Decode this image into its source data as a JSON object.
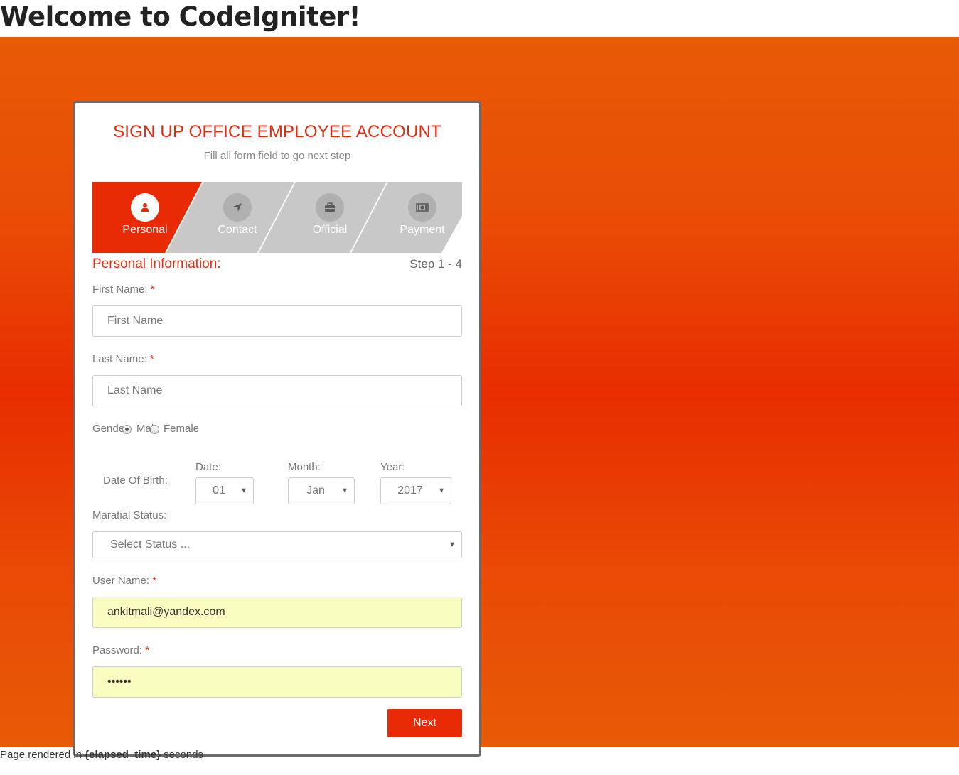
{
  "page": {
    "heading": "Welcome to CodeIgniter!",
    "footer": {
      "prefix": "Page rendered in",
      "elapsed": "{elapsed_time}",
      "suffix": "seconds"
    }
  },
  "form": {
    "title": "SIGN UP OFFICE EMPLOYEE ACCOUNT",
    "subtitle": "Fill all form field to go next step",
    "steps": [
      {
        "label": "Personal",
        "icon": "user-icon",
        "active": true
      },
      {
        "label": "Contact",
        "icon": "location-arrow-icon",
        "active": false
      },
      {
        "label": "Official",
        "icon": "briefcase-icon",
        "active": false
      },
      {
        "label": "Payment",
        "icon": "money-icon",
        "active": false
      }
    ],
    "section_title": "Personal Information:",
    "step_count": "Step 1 - 4",
    "first_name": {
      "label": "First Name:",
      "required": "*",
      "placeholder": "First Name"
    },
    "last_name": {
      "label": "Last Name:",
      "required": "*",
      "placeholder": "Last Name"
    },
    "gender": {
      "label": "Gender:",
      "options": [
        "Male",
        "Female"
      ],
      "selected": "Male"
    },
    "dob": {
      "label": "Date Of Birth:",
      "date": {
        "label": "Date:",
        "value": "01"
      },
      "month": {
        "label": "Month:",
        "value": "Jan"
      },
      "year": {
        "label": "Year:",
        "value": "2017"
      }
    },
    "marital_status": {
      "label": "Maratial Status:",
      "value": "Select Status ..."
    },
    "username": {
      "label": "User Name:",
      "required": "*",
      "value": "ankitmali@yandex.com"
    },
    "password": {
      "label": "Password:",
      "required": "*",
      "value": "••••••"
    },
    "next_label": "Next"
  },
  "colors": {
    "accent": "#e82a05",
    "step_inactive": "#c8c8c8",
    "autofill": "#fafdc0"
  }
}
